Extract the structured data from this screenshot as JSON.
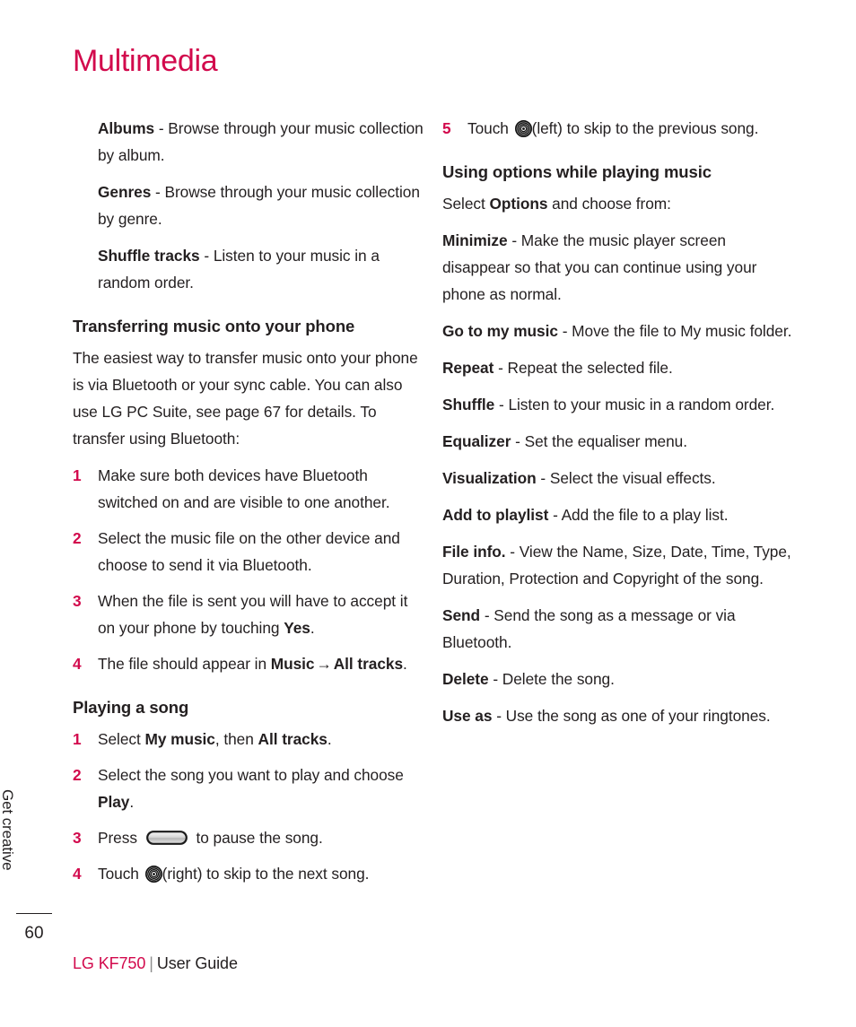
{
  "page": {
    "title": "Multimedia",
    "number": "60",
    "side_tab_label": "Get creative",
    "accent_color": "#d2094c",
    "text_color": "#231f20"
  },
  "footer": {
    "brand": "LG KF750",
    "separator": "|",
    "guide": "User Guide"
  },
  "left_column": {
    "definitions": [
      {
        "term": "Albums",
        "dash": " - ",
        "desc": "Browse through your music collection by album."
      },
      {
        "term": "Genres",
        "dash": " - ",
        "desc": "Browse through your music collection by genre."
      },
      {
        "term": "Shuffle tracks",
        "dash": " - ",
        "desc": "Listen to your music in a random order."
      }
    ],
    "transferring": {
      "heading": "Transferring music onto your phone",
      "intro": "The easiest way to transfer music onto your phone is via Bluetooth or your sync cable. You can also use LG PC Suite, see page 67 for details. To transfer using Bluetooth:",
      "steps": [
        {
          "num": "1",
          "text_a": "Make sure both devices have Bluetooth switched on and are visible to one another.",
          "bold_b": "",
          "text_c": ""
        },
        {
          "num": "2",
          "text_a": "Select the music file on the other device and choose to send it via Bluetooth.",
          "bold_b": "",
          "text_c": ""
        },
        {
          "num": "3",
          "text_a": "When the file is sent you will have to accept it on your phone by touching ",
          "bold_b": "Yes",
          "text_c": "."
        },
        {
          "num": "4",
          "text_a": "The file should appear in ",
          "bold_b": "Music",
          "arrow": "→",
          "bold_d": "All tracks",
          "text_c": "."
        }
      ]
    },
    "playing": {
      "heading": "Playing a song",
      "steps": [
        {
          "num": "1",
          "text_a": "Select ",
          "bold_b": "My music",
          "text_c": ", then ",
          "bold_d": "All tracks",
          "text_e": "."
        },
        {
          "num": "2",
          "text_a": "Select the song you want to play and choose ",
          "bold_b": "Play",
          "text_c": "."
        },
        {
          "num": "3",
          "text_a": "Press ",
          "icon": "pill-button-icon",
          "text_c": " to pause the song."
        },
        {
          "num": "4",
          "text_a": "Touch ",
          "icon": "navigation-wheel-icon",
          "text_c": "(right) to skip to the next song."
        }
      ]
    }
  },
  "right_column": {
    "step5": {
      "num": "5",
      "text_a": "Touch ",
      "icon": "navigation-wheel-icon",
      "text_c": "(left) to skip to the previous song."
    },
    "options": {
      "heading": "Using options while playing music",
      "intro_a": "Select ",
      "intro_bold": "Options",
      "intro_b": " and choose from:",
      "items": [
        {
          "term": "Minimize",
          "dash": " - ",
          "desc": "Make the music player screen disappear so that you can continue using your phone as normal."
        },
        {
          "term": "Go to my music",
          "dash": " - ",
          "desc": "Move the file to My music folder."
        },
        {
          "term": "Repeat",
          "dash": " - ",
          "desc": "Repeat the selected file."
        },
        {
          "term": "Shuffle",
          "dash": " - ",
          "desc": "Listen to your music in a random order."
        },
        {
          "term": "Equalizer",
          "dash": " - ",
          "desc": "Set the equaliser menu."
        },
        {
          "term": "Visualization",
          "dash": " - ",
          "desc": "Select the visual effects."
        },
        {
          "term": "Add to playlist",
          "dash": " - ",
          "desc": "Add the file to a play list."
        },
        {
          "term": "File info.",
          "dash": " - ",
          "desc": "View the Name, Size, Date, Time, Type, Duration, Protection and Copyright of the song."
        },
        {
          "term": "Send",
          "dash": " - ",
          "desc": "Send the song as a message or via Bluetooth."
        },
        {
          "term": "Delete",
          "dash": " - ",
          "desc": "Delete the song."
        },
        {
          "term": "Use as",
          "dash": " - ",
          "desc": "Use the song as one of your ringtones."
        }
      ]
    }
  }
}
